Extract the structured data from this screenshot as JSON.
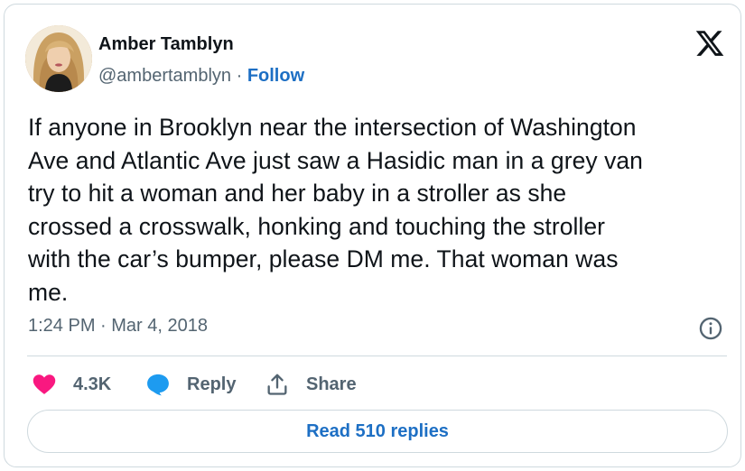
{
  "author": {
    "name": "Amber Tamblyn",
    "handle": "@ambertamblyn",
    "separator": " · ",
    "follow_label": "Follow"
  },
  "tweet": {
    "lines": [
      "If anyone in Brooklyn near the intersection of Washington",
      "Ave and Atlantic Ave just saw a Hasidic man in a grey van",
      "try to hit a woman and her baby in a stroller as she",
      "crossed a crosswalk, honking and touching the stroller",
      "with the car’s bumper, please DM me. That woman was",
      "me."
    ],
    "timestamp": "1:24 PM · Mar 4, 2018"
  },
  "actions": {
    "like_count": "4.3K",
    "reply_label": "Reply",
    "share_label": "Share"
  },
  "read_replies_label": "Read 510 replies",
  "colors": {
    "like": "#f91880",
    "reply": "#1d9bf0",
    "link": "#1d6fc4",
    "muted": "#536471",
    "border": "#cfd9de"
  },
  "icons": {
    "platform": "x-logo-icon",
    "info": "info-icon",
    "like": "heart-icon",
    "reply": "speech-bubble-icon",
    "share": "share-upload-icon"
  }
}
